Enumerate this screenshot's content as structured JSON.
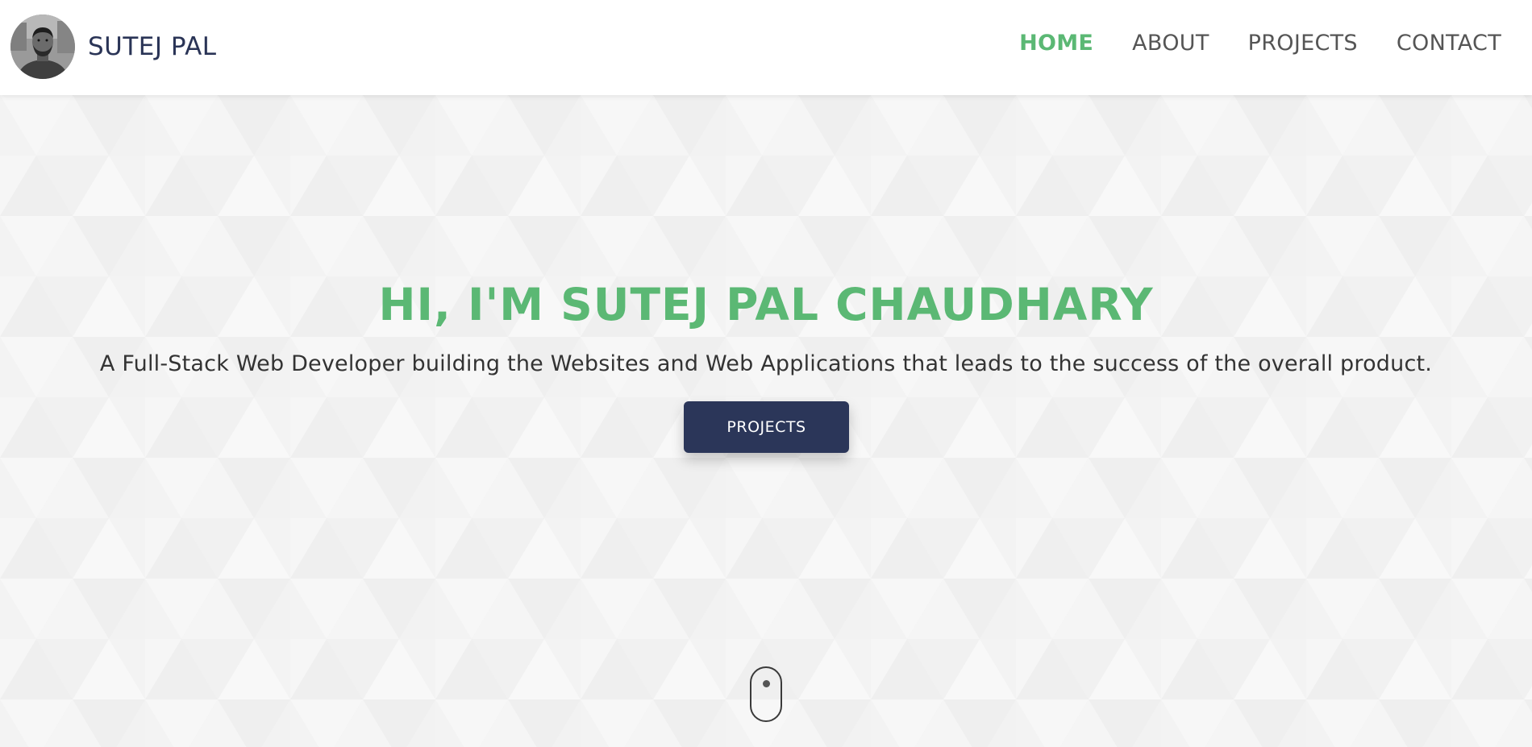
{
  "header": {
    "brand_name": "SUTEJ PAL",
    "nav": [
      {
        "label": "HOME",
        "active": true
      },
      {
        "label": "ABOUT",
        "active": false
      },
      {
        "label": "PROJECTS",
        "active": false
      },
      {
        "label": "CONTACT",
        "active": false
      }
    ]
  },
  "hero": {
    "title": "HI, I'M SUTEJ PAL CHAUDHARY",
    "subtitle": "A Full-Stack Web Developer building the Websites and Web Applications that leads to the success of the overall product.",
    "button_label": "PROJECTS"
  },
  "colors": {
    "accent_green": "#5bb874",
    "brand_navy": "#2b3659",
    "background": "#f3f3f3"
  },
  "icons": {
    "scroll": "mouse-scroll-icon"
  }
}
